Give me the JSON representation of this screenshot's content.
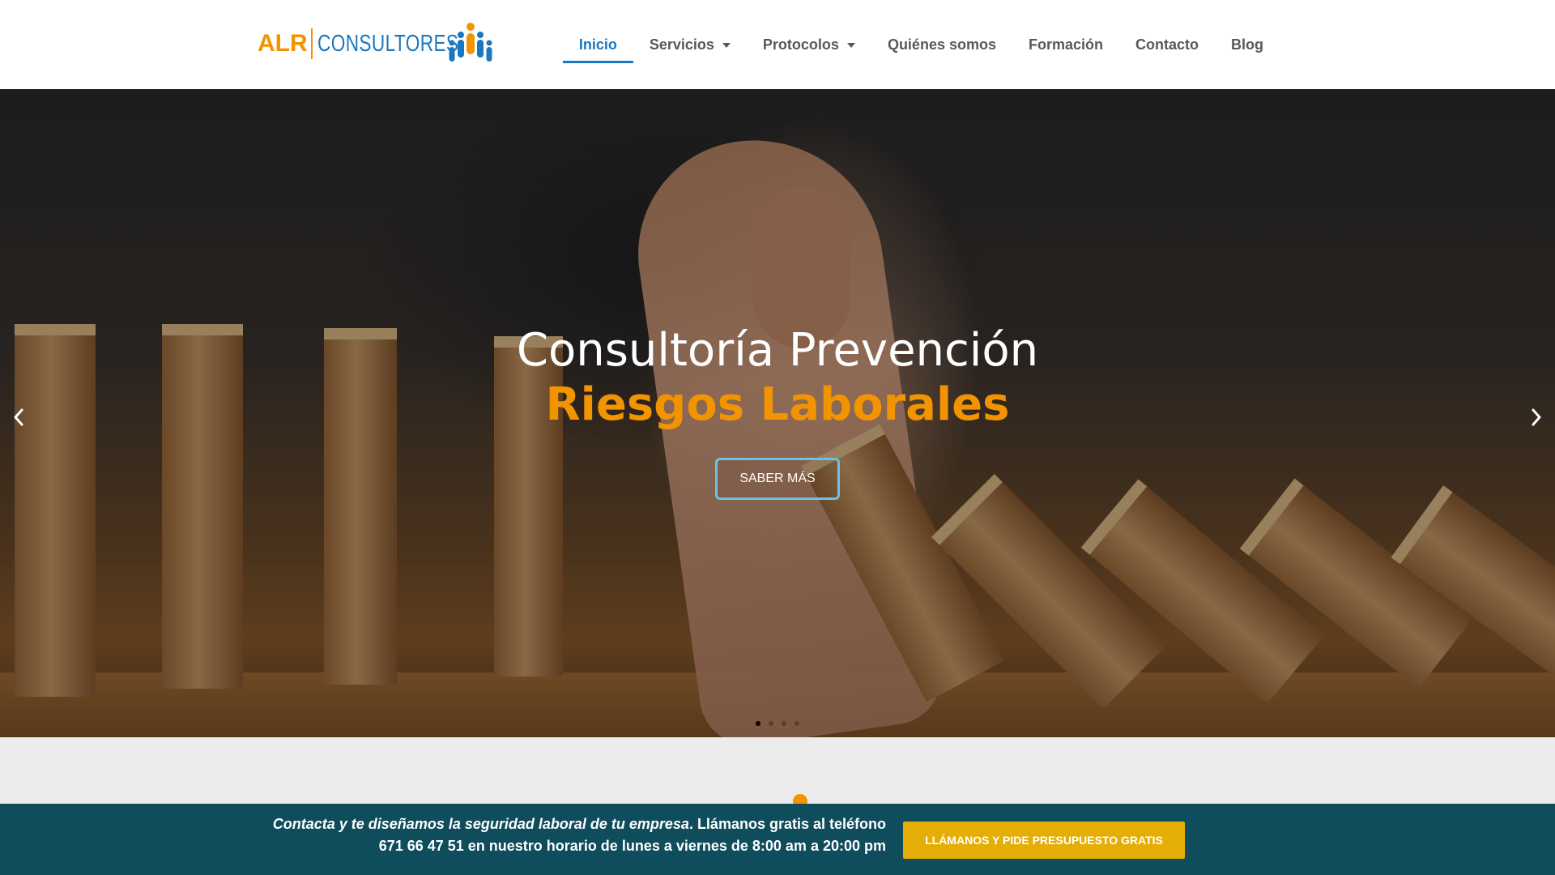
{
  "brand": {
    "logo_alr": "ALR",
    "logo_consultores": "CONSULTORES",
    "primary_color": "#1a78c2",
    "accent_color": "#f29400"
  },
  "nav": {
    "items": [
      {
        "label": "Inicio",
        "active": true
      },
      {
        "label": "Servicios",
        "has_dropdown": true
      },
      {
        "label": "Protocolos",
        "has_dropdown": true
      },
      {
        "label": "Quiénes somos"
      },
      {
        "label": "Formación"
      },
      {
        "label": "Contacto"
      },
      {
        "label": "Blog"
      }
    ]
  },
  "hero": {
    "title": "Consultoría Prevención",
    "subtitle": "Riesgos Laborales",
    "button_label": "SABER MÁS",
    "prev_icon": "chevron-left-icon",
    "next_icon": "chevron-right-icon",
    "slides_total": 4,
    "active_slide": 1
  },
  "cta_bar": {
    "text_italic": "Contacta y te diseñamos la seguridad laboral de tu empresa",
    "text_rest": ". Llámanos gratis al teléfono",
    "text_line2": "671 66 47 51 en nuestro horario de lunes a viernes de 8:00 am a 20:00 pm",
    "button_label": "LLÁMANOS Y PIDE PRESUPUESTO GRATIS",
    "background": "#0f4c5c",
    "button_color": "#e5ae06"
  }
}
